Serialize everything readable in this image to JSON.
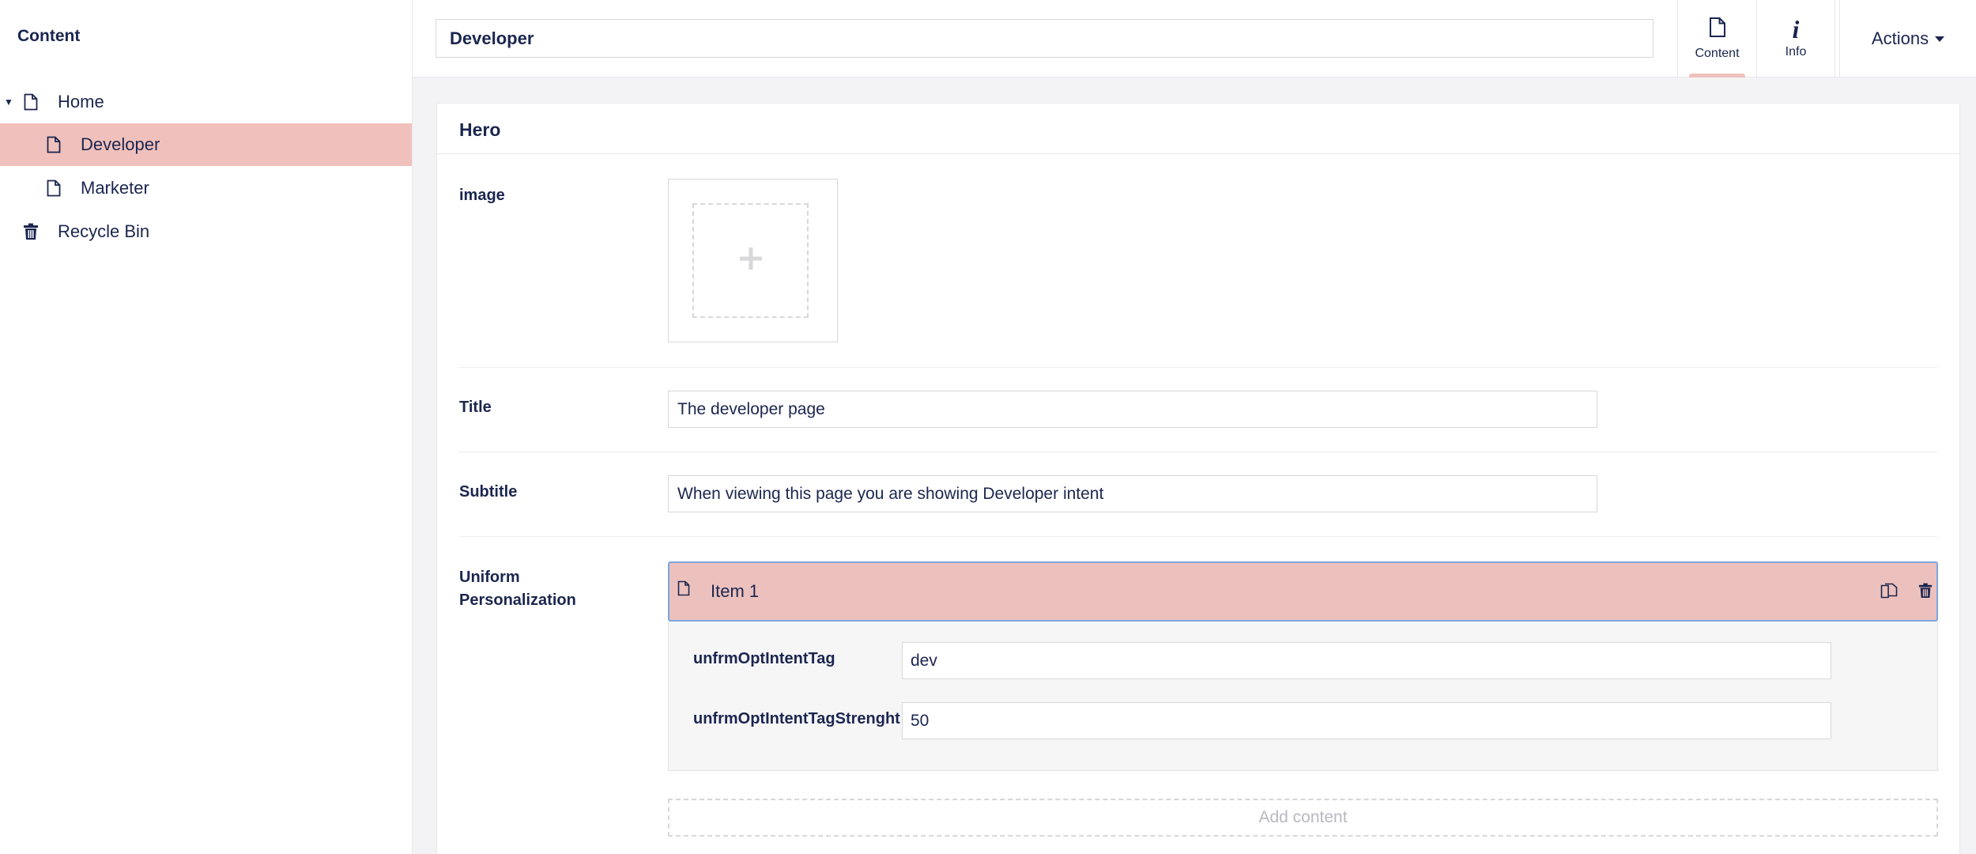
{
  "sidebar": {
    "header": "Content",
    "items": [
      {
        "label": "Home"
      },
      {
        "label": "Developer"
      },
      {
        "label": "Marketer"
      },
      {
        "label": "Recycle Bin"
      }
    ]
  },
  "header": {
    "name_value": "Developer",
    "tabs": [
      {
        "label": "Content",
        "icon": "document-icon"
      },
      {
        "label": "Info",
        "icon": "info-icon"
      }
    ],
    "actions_label": "Actions"
  },
  "group": {
    "title": "Hero"
  },
  "properties": {
    "image_label": "image",
    "title_label": "Title",
    "title_value": "The developer page",
    "subtitle_label": "Subtitle",
    "subtitle_value": "When viewing this page you are showing Developer intent",
    "personalization_label_line1": "Uniform",
    "personalization_label_line2": "Personalization"
  },
  "block": {
    "item_label": "Item 1",
    "fields": [
      {
        "label": "unfrmOptIntentTag",
        "value": "dev"
      },
      {
        "label": "unfrmOptIntentTagStrenght",
        "value": "50"
      }
    ],
    "add_content_label": "Add content"
  },
  "colors": {
    "accent": "#f0c1bc",
    "text": "#1b264f",
    "focus_border": "#7ba7e0"
  }
}
